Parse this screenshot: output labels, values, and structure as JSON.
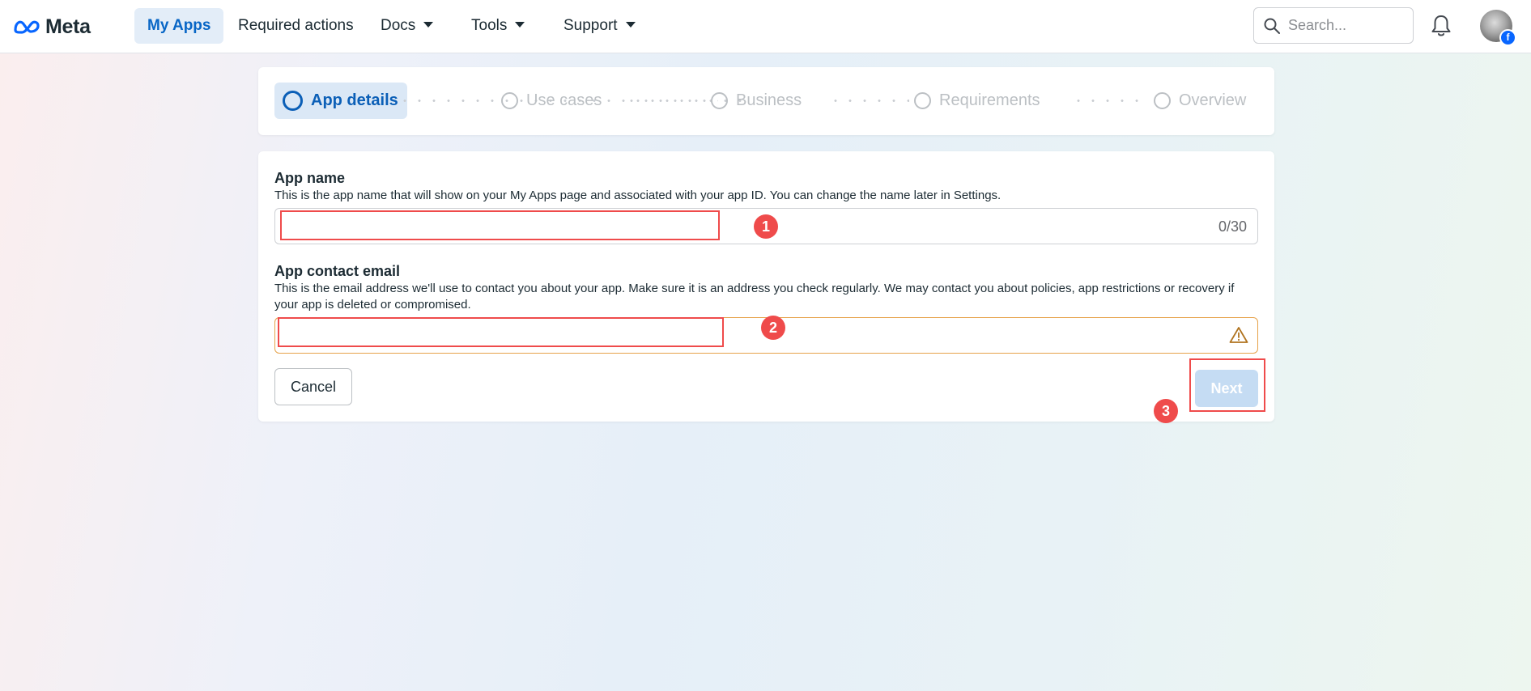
{
  "header": {
    "brand": "Meta",
    "nav": [
      {
        "label": "My Apps",
        "active": true
      },
      {
        "label": "Required actions"
      },
      {
        "label": "Docs",
        "dropdown": true
      },
      {
        "label": "Tools",
        "dropdown": true
      },
      {
        "label": "Support",
        "dropdown": true
      }
    ],
    "search_placeholder": "Search...",
    "avatar_badge": "f"
  },
  "stepper": {
    "steps": [
      {
        "label": "App details",
        "active": true
      },
      {
        "label": "Use cases"
      },
      {
        "label": "Business"
      },
      {
        "label": "Requirements"
      },
      {
        "label": "Overview"
      }
    ]
  },
  "form": {
    "app_name": {
      "label": "App name",
      "help": "This is the app name that will show on your My Apps page and associated with your app ID. You can change the name later in Settings.",
      "value": "",
      "counter": "0/30"
    },
    "app_email": {
      "label": "App contact email",
      "help": "This is the email address we'll use to contact you about your app. Make sure it is an address you check regularly. We may contact you about policies, app restrictions or recovery if your app is deleted or compromised.",
      "value": "",
      "state": "warning"
    },
    "cancel_label": "Cancel",
    "next_label": "Next"
  },
  "annotations": [
    "1",
    "2",
    "3"
  ],
  "colors": {
    "accent": "#0b5fb7",
    "annotation": "#ef4b4b",
    "warning": "#e6a24a",
    "next_disabled": "#c5dcf3"
  }
}
